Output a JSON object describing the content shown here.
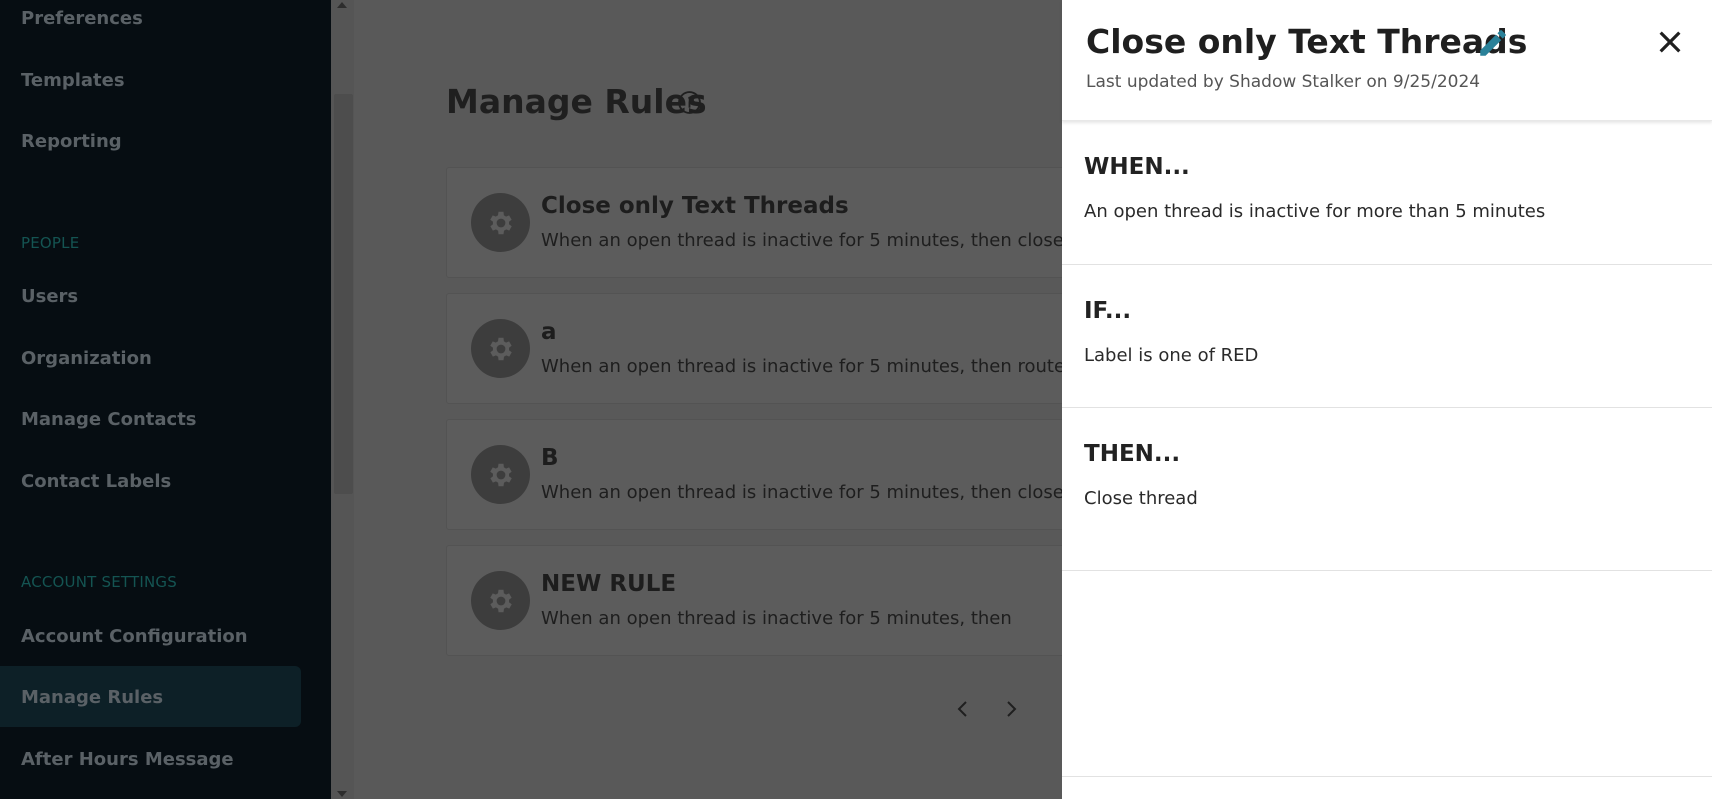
{
  "sidebar": {
    "items": [
      {
        "label": "Preferences"
      },
      {
        "label": "Templates"
      },
      {
        "label": "Reporting"
      }
    ],
    "people_section": {
      "label": "PEOPLE",
      "items": [
        {
          "label": "Users"
        },
        {
          "label": "Organization"
        },
        {
          "label": "Manage Contacts"
        },
        {
          "label": "Contact Labels"
        }
      ]
    },
    "account_section": {
      "label": "ACCOUNT SETTINGS",
      "items": [
        {
          "label": "Account Configuration"
        },
        {
          "label": "Manage Rules",
          "active": true
        },
        {
          "label": "After Hours Message"
        }
      ]
    }
  },
  "main": {
    "title": "Manage Rules",
    "rules": [
      {
        "name": "Close only Text Threads",
        "description": "When an open thread is inactive for 5 minutes, then close"
      },
      {
        "name": "a",
        "description": "When an open thread is inactive for 5 minutes, then route"
      },
      {
        "name": "B",
        "description": "When an open thread is inactive for 5 minutes, then close"
      },
      {
        "name": "NEW RULE",
        "description": "When an open thread is inactive for 5 minutes, then"
      }
    ]
  },
  "drawer": {
    "title": "Close only Text Threads",
    "subtitle": "Last updated by Shadow Stalker on 9/25/2024",
    "sections": {
      "when": {
        "heading": "WHEN...",
        "text": "An open thread is inactive for more than 5 minutes"
      },
      "if": {
        "heading": "IF...",
        "text": "Label is one of RED"
      },
      "then": {
        "heading": "THEN...",
        "text": "Close thread"
      }
    }
  },
  "colors": {
    "sidebar_bg": "#060d12",
    "accent_teal": "#2a8199",
    "overlay_dim": "#595959"
  }
}
